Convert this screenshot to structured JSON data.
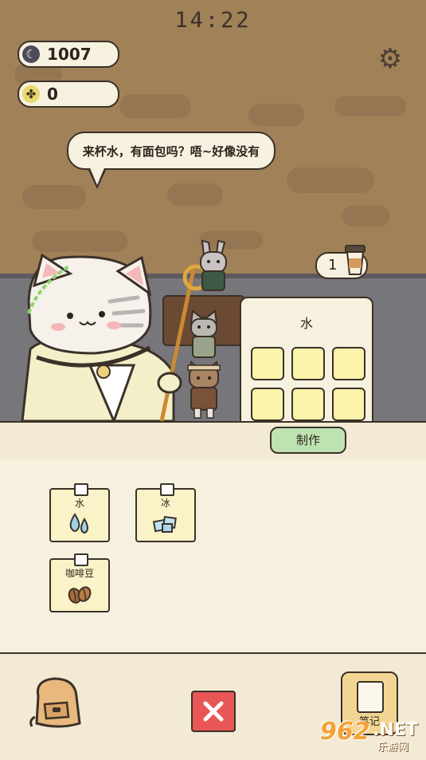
{
  "status_bar": {
    "time": "14:22"
  },
  "currency": {
    "moon_coins": {
      "icon": "moon-icon",
      "value": "1007"
    },
    "clover_coins": {
      "icon": "clover-icon",
      "value": "0"
    }
  },
  "settings": {
    "icon": "gear-icon"
  },
  "customer": {
    "speech": "来杯水，有面包吗？唔~好像没有"
  },
  "order": {
    "count": "1",
    "icon": "coffee-cup-icon"
  },
  "crafting": {
    "target_name": "水",
    "slots": [
      "",
      "",
      "",
      "",
      "",
      ""
    ],
    "make_label": "制作"
  },
  "ingredients": [
    {
      "name": "水",
      "icon": "water-drops-icon"
    },
    {
      "name": "冰",
      "icon": "ice-cubes-icon"
    },
    {
      "name": "咖啡豆",
      "icon": "coffee-beans-icon"
    }
  ],
  "bottom_bar": {
    "bag_icon": "backpack-icon",
    "close_icon": "close-icon",
    "notes_label": "笔记",
    "notes_icon": "notebook-icon"
  },
  "watermark": {
    "logo": "962",
    "suffix": ".NET",
    "sub": "乐游网"
  },
  "colors": {
    "wall": "#a08158",
    "counter": "#77767a",
    "make_button": "#bfe3b0",
    "close_button": "#e85656",
    "slot": "#fbf2ab"
  }
}
